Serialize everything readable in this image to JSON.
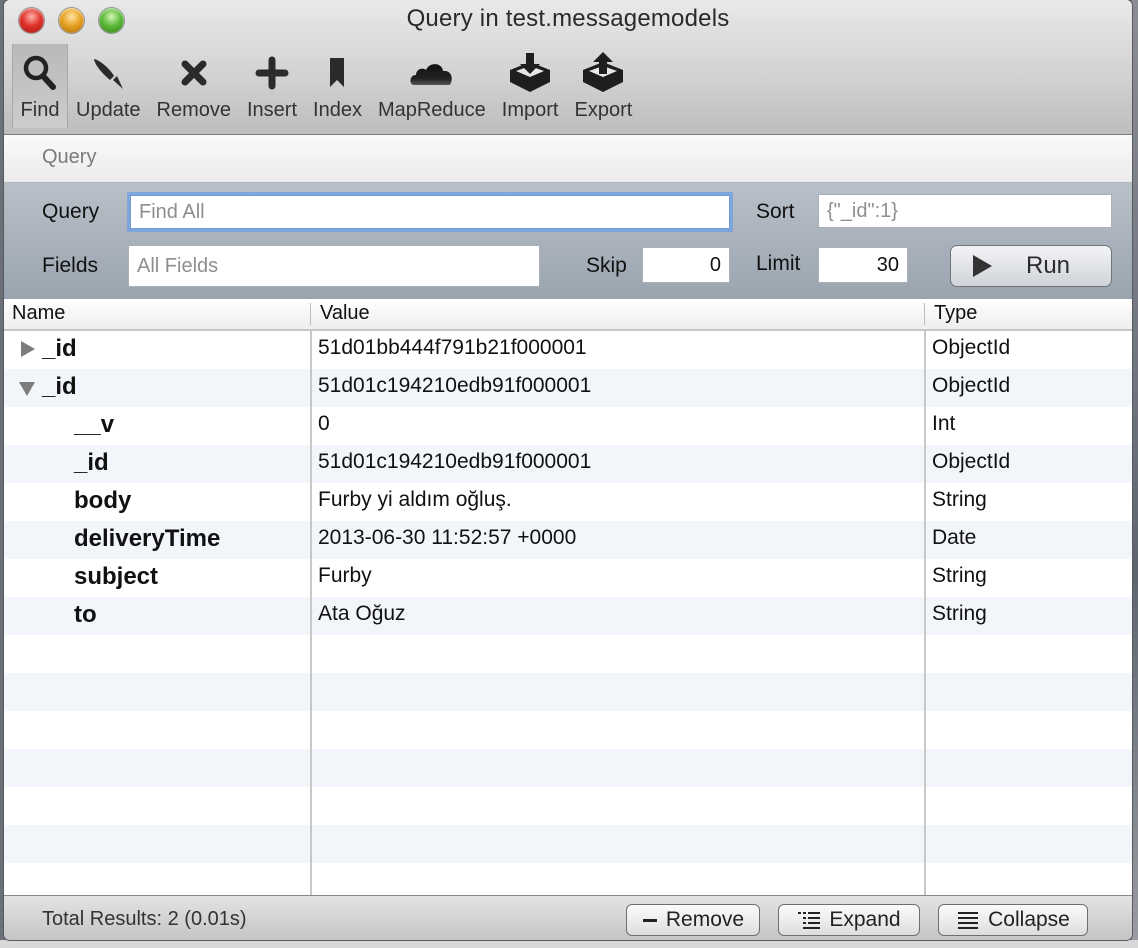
{
  "window": {
    "title": "Query in test.messagemodels"
  },
  "toolbar": {
    "items": [
      {
        "label": "Find",
        "icon": "magnifier-icon",
        "active": true
      },
      {
        "label": "Update",
        "icon": "paintbrush-icon"
      },
      {
        "label": "Remove",
        "icon": "x-icon"
      },
      {
        "label": "Insert",
        "icon": "plus-icon"
      },
      {
        "label": "Index",
        "icon": "bookmark-icon"
      },
      {
        "label": "MapReduce",
        "icon": "cloud-icon"
      },
      {
        "label": "Import",
        "icon": "import-box-icon"
      },
      {
        "label": "Export",
        "icon": "export-box-icon"
      }
    ]
  },
  "section": {
    "title": "Query"
  },
  "form": {
    "query_label": "Query",
    "query_value": "",
    "query_placeholder": "Find All",
    "sort_label": "Sort",
    "sort_value": "",
    "sort_placeholder": "{\"_id\":1}",
    "fields_label": "Fields",
    "fields_value": "",
    "fields_placeholder": "All Fields",
    "skip_label": "Skip",
    "skip_value": "0",
    "limit_label": "Limit",
    "limit_value": "30",
    "run_label": "Run"
  },
  "table": {
    "columns": [
      "Name",
      "Value",
      "Type"
    ],
    "rows": [
      {
        "name": "_id",
        "value": "51d01bb444f791b21f000001",
        "type": "ObjectId",
        "level": 0,
        "disclosure": "collapsed"
      },
      {
        "name": "_id",
        "value": "51d01c194210edb91f000001",
        "type": "ObjectId",
        "level": 0,
        "disclosure": "expanded"
      },
      {
        "name": "__v",
        "value": "0",
        "type": "Int",
        "level": 1
      },
      {
        "name": "_id",
        "value": "51d01c194210edb91f000001",
        "type": "ObjectId",
        "level": 1
      },
      {
        "name": "body",
        "value": "Furby yi aldım oğluş.",
        "type": "String",
        "level": 1
      },
      {
        "name": "deliveryTime",
        "value": "2013-06-30 11:52:57 +0000",
        "type": "Date",
        "level": 1
      },
      {
        "name": "subject",
        "value": "Furby",
        "type": "String",
        "level": 1
      },
      {
        "name": "to",
        "value": "Ata Oğuz",
        "type": "String",
        "level": 1
      }
    ],
    "empty_row_count": 7
  },
  "footer": {
    "status": "Total Results: 2 (0.01s)",
    "remove_label": "Remove",
    "expand_label": "Expand",
    "collapse_label": "Collapse"
  }
}
